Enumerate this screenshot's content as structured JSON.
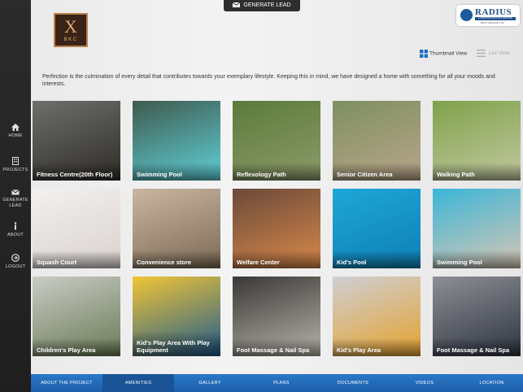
{
  "header": {
    "generate_lead_label": "GENERATE LEAD",
    "brand_logo": {
      "mark": "X",
      "text": "BKC"
    },
    "partner_logo": {
      "name": "RADIUS",
      "subtitle": "A SHAPOORJI PALLONJI VENTURE",
      "tagline": "BUILT AROUND YOU"
    }
  },
  "sidebar": {
    "items": [
      {
        "label": "HOME",
        "icon": "home-icon"
      },
      {
        "label": "PROJECTS",
        "icon": "building-icon"
      },
      {
        "label": "GENERATE",
        "label2": "LEAD",
        "icon": "envelope-icon"
      },
      {
        "label": "ABOUT",
        "icon": "info-icon"
      },
      {
        "label": "LOGOUT",
        "icon": "logout-icon"
      }
    ]
  },
  "view": {
    "thumbnail_label": "Thumbnail View",
    "list_label": "List View",
    "active": "thumbnail"
  },
  "intro_text": "Perfection is the culmination of every detail that contributes towards your exemplary lifestyle. Keeping this in mind, we have designed a home with something for all your moods and interests.",
  "amenities": [
    {
      "title": "Fitness Centre(20th Floor)",
      "colors": [
        "#6d6f6c",
        "#2f2b27"
      ]
    },
    {
      "title": "Swimming Pool",
      "colors": [
        "#3f5a4e",
        "#5fd0d8"
      ]
    },
    {
      "title": "Reflexology Path",
      "colors": [
        "#5b7b3a",
        "#8c9a6a"
      ]
    },
    {
      "title": "Senior Citizen Area",
      "colors": [
        "#7e9060",
        "#b9a58a"
      ]
    },
    {
      "title": "Walking Path",
      "colors": [
        "#7fa24a",
        "#c2c8a0"
      ]
    },
    {
      "title": "Squash Court",
      "colors": [
        "#f3f0ee",
        "#d9d2cf"
      ]
    },
    {
      "title": "Convenience store",
      "colors": [
        "#c9b7a1",
        "#7c6a55"
      ]
    },
    {
      "title": "Welfare Center",
      "colors": [
        "#6b4a3a",
        "#d8884a"
      ]
    },
    {
      "title": "Kid's Pool",
      "colors": [
        "#1ea7d7",
        "#0e7fb5"
      ]
    },
    {
      "title": "Swimming Pool",
      "colors": [
        "#3bb6d8",
        "#d7c6b3"
      ]
    },
    {
      "title": "Children's Play Area",
      "colors": [
        "#c9ccc6",
        "#6a7a55"
      ]
    },
    {
      "title": "Kid's Play Area With Play Equipment",
      "colors": [
        "#f1c534",
        "#1f5c8e"
      ]
    },
    {
      "title": "Foot Massage & Nail Spa",
      "colors": [
        "#3a3836",
        "#b7b2aa"
      ]
    },
    {
      "title": "Kid's Play Area",
      "colors": [
        "#cfcfd4",
        "#e5a22e"
      ]
    },
    {
      "title": "Foot Massage & Nail Spa",
      "colors": [
        "#8d8f95",
        "#2e3440"
      ]
    }
  ],
  "bottom_nav": {
    "items": [
      {
        "label": "ABOUT THE PROJECT"
      },
      {
        "label": "AMENITIES"
      },
      {
        "label": "GALLERY"
      },
      {
        "label": "PLANS"
      },
      {
        "label": "DOCUMENTS"
      },
      {
        "label": "VIDEOS"
      },
      {
        "label": "LOCATION"
      }
    ],
    "active_index": 1
  },
  "colors": {
    "nav_blue": "#2a78c8",
    "nav_active": "#1a5496",
    "sidebar_bg": "#252525",
    "brand_gold": "#b9814e"
  }
}
